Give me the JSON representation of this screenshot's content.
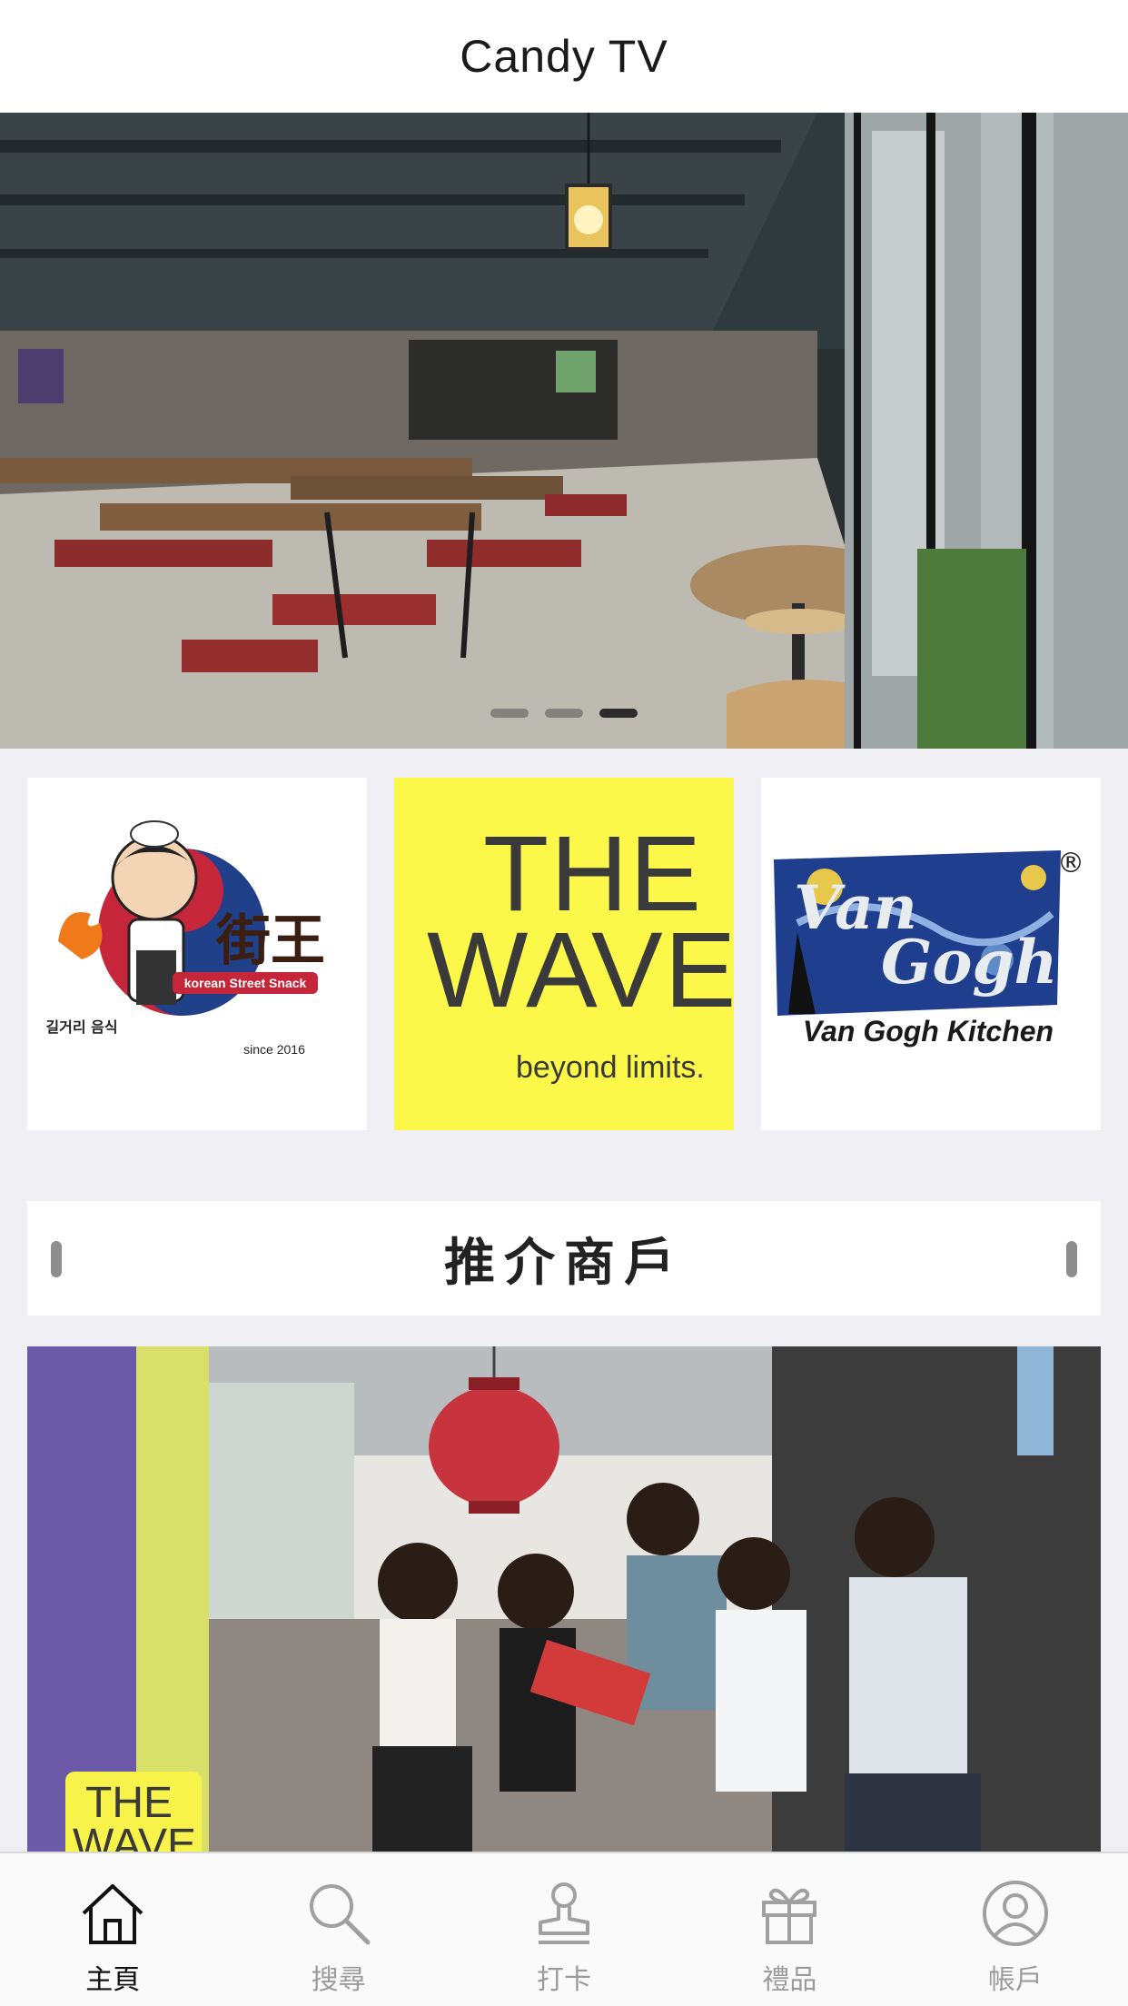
{
  "navbar": {
    "title": "Candy TV"
  },
  "hero": {
    "slides_total": 3,
    "active_slide": 3
  },
  "tiles": [
    {
      "name": "jie-wang",
      "korean": "길거리 음식",
      "cn": "街王",
      "tag": "korean Street Snack",
      "since": "since 2016"
    },
    {
      "name": "the-wave",
      "line1": "THE",
      "line2": "WAVE",
      "tagline": "beyond limits."
    },
    {
      "name": "van-gogh",
      "line1": "Van",
      "line2": "Gogh",
      "caption": "Van Gogh Kitchen",
      "mark": "®"
    }
  ],
  "section": {
    "title": "推介商戶"
  },
  "featured": {
    "badge_line1": "THE",
    "badge_line2": "WAVE"
  },
  "tabs": [
    {
      "label": "主頁",
      "icon": "home-icon",
      "active": true
    },
    {
      "label": "搜尋",
      "icon": "search-icon",
      "active": false
    },
    {
      "label": "打卡",
      "icon": "stamp-icon",
      "active": false
    },
    {
      "label": "禮品",
      "icon": "gift-icon",
      "active": false
    },
    {
      "label": "帳戶",
      "icon": "account-icon",
      "active": false
    }
  ],
  "colors": {
    "active_tab": "#111111",
    "inactive_tab": "#9b9b9b",
    "wave_yellow": "#fbf84a"
  }
}
